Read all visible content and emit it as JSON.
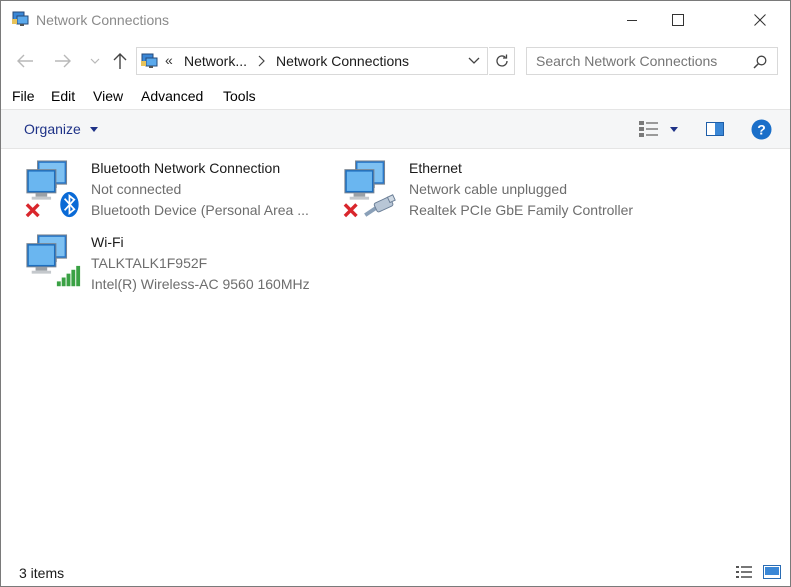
{
  "window": {
    "title": "Network Connections"
  },
  "icons": {
    "app": "network-connections-icon",
    "minimize": "minimize-icon",
    "maximize": "maximize-icon",
    "close": "close-icon",
    "back": "back-arrow-icon",
    "forward": "forward-arrow-icon",
    "recent": "chevron-down-icon",
    "up": "up-arrow-icon",
    "refresh": "refresh-icon",
    "search": "search-icon",
    "help": "help-icon"
  },
  "address": {
    "overflow": "«",
    "crumbs": [
      "Network...",
      "Network Connections"
    ]
  },
  "search": {
    "placeholder": "Search Network Connections"
  },
  "menu": [
    "File",
    "Edit",
    "View",
    "Advanced",
    "Tools"
  ],
  "toolbar": {
    "organize_label": "Organize"
  },
  "connections": [
    {
      "name": "Bluetooth Network Connection",
      "status": "Not connected",
      "device": "Bluetooth Device (Personal Area ...",
      "badge": "bluetooth-icon",
      "overlay": "disconnected-x-icon"
    },
    {
      "name": "Ethernet",
      "status": "Network cable unplugged",
      "device": "Realtek PCIe GbE Family Controller",
      "badge": "ethernet-cable-icon",
      "overlay": "disconnected-x-icon"
    },
    {
      "name": "Wi-Fi",
      "status": "TALKTALK1F952F",
      "device": "Intel(R) Wireless-AC 9560 160MHz",
      "badge": "wifi-signal-bars-icon",
      "overlay": ""
    }
  ],
  "statusbar": {
    "count": "3 items"
  },
  "colors": {
    "accent": "#1e3287",
    "help": "#1a6fc9",
    "error": "#d9262c",
    "wifi": "#3aa144",
    "bluetooth": "#0a6ad6"
  }
}
